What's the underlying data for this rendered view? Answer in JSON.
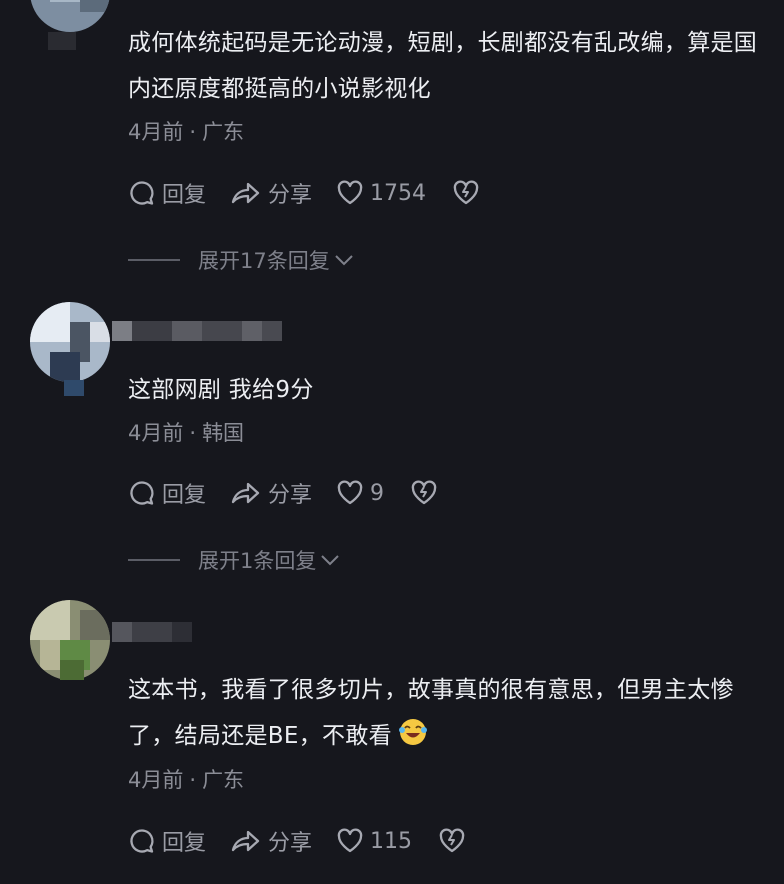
{
  "comments": [
    {
      "text": "成何体统起码是无论动漫，短剧，长剧都没有乱改编，算是国内还原度都挺高的小说影视化",
      "time": "4月前",
      "location": "广东",
      "reply_label": "回复",
      "share_label": "分享",
      "likes": "1754",
      "expand_label": "展开17条回复"
    },
    {
      "text": "这部网剧 我给9分",
      "time": "4月前",
      "location": "韩国",
      "reply_label": "回复",
      "share_label": "分享",
      "likes": "9",
      "expand_label": "展开1条回复"
    },
    {
      "text": "这本书，我看了很多切片，故事真的很有意思，但男主太惨了，结局还是BE，不敢看",
      "emoji": "laughing-crying-emoji",
      "time": "4月前",
      "location": "广东",
      "reply_label": "回复",
      "share_label": "分享",
      "likes": "115"
    }
  ],
  "meta_separator": "·",
  "colors": {
    "background": "#16171d",
    "text": "#eceef2",
    "muted": "#8b8d96",
    "emoji": "#f5c842"
  },
  "icons": [
    "comment-icon",
    "share-arrow-icon",
    "heart-icon",
    "broken-heart-icon",
    "chevron-down-icon"
  ]
}
